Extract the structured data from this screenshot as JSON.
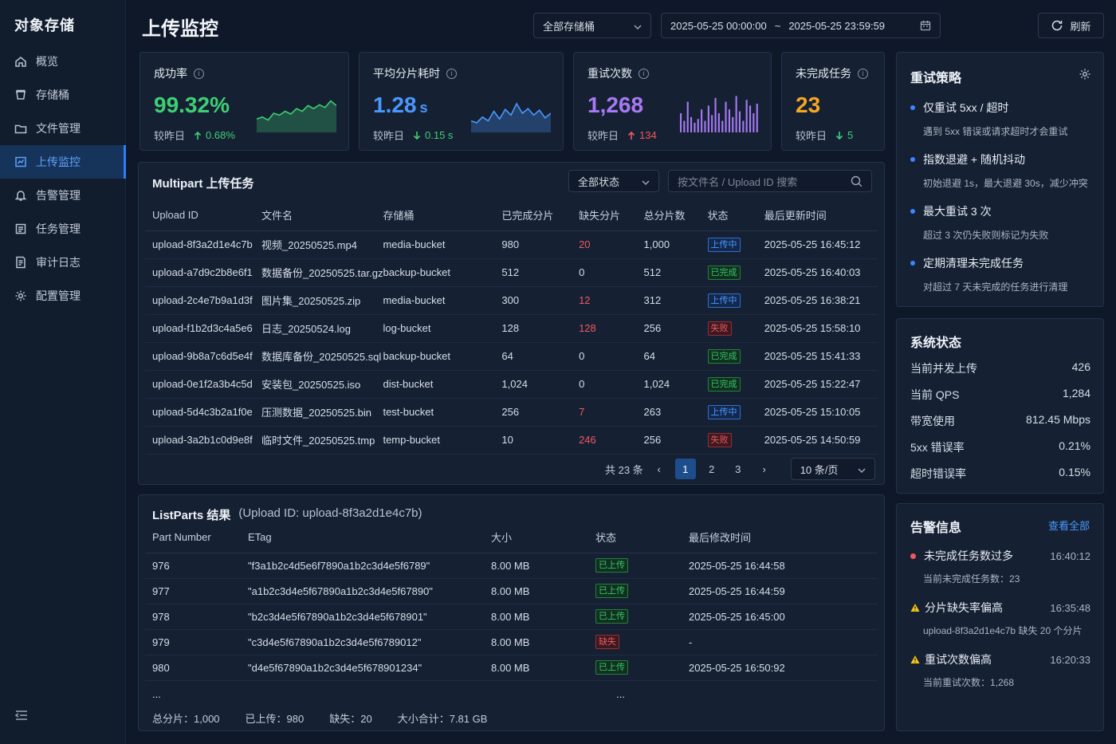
{
  "app": {
    "brand": "对象存储",
    "page_title": "上传监控"
  },
  "nav": [
    {
      "label": "概览",
      "icon": "home-icon"
    },
    {
      "label": "存储桶",
      "icon": "bucket-icon"
    },
    {
      "label": "文件管理",
      "icon": "folder-icon"
    },
    {
      "label": "上传监控",
      "icon": "monitor-icon",
      "active": true
    },
    {
      "label": "告警管理",
      "icon": "bell-icon"
    },
    {
      "label": "任务管理",
      "icon": "list-icon"
    },
    {
      "label": "审计日志",
      "icon": "log-icon"
    },
    {
      "label": "配置管理",
      "icon": "gear-icon"
    }
  ],
  "toolbar": {
    "bucket_select": "全部存储桶",
    "date_start": "2025-05-25 00:00:00",
    "date_sep": "~",
    "date_end": "2025-05-25 23:59:59",
    "refresh": "刷新"
  },
  "kpis": [
    {
      "label": "成功率",
      "value": "99.32%",
      "unit": "",
      "cmp": "较昨日",
      "delta": "0.68%",
      "dir": "up",
      "color": "#3ecf74",
      "trend": [
        0.35,
        0.4,
        0.32,
        0.5,
        0.45,
        0.55,
        0.48,
        0.62,
        0.55,
        0.7,
        0.62,
        0.72,
        0.65,
        0.82,
        0.7
      ]
    },
    {
      "label": "平均分片耗时",
      "value": "1.28",
      "unit": "s",
      "cmp": "较昨日",
      "delta": "0.15 s",
      "dir": "down",
      "color": "#4a98ff",
      "trend": [
        0.3,
        0.25,
        0.4,
        0.3,
        0.55,
        0.35,
        0.6,
        0.45,
        0.75,
        0.5,
        0.62,
        0.45,
        0.58,
        0.38,
        0.5
      ]
    },
    {
      "label": "重试次数",
      "value": "1,268",
      "unit": "",
      "cmp": "较昨日",
      "delta": "134",
      "dir": "up",
      "color": "#a779f5",
      "trend": [
        0.5,
        0.3,
        0.8,
        0.4,
        0.25,
        0.35,
        0.6,
        0.3,
        0.7,
        0.45,
        0.9,
        0.5,
        0.3,
        0.8,
        0.6,
        0.4,
        0.95,
        0.55,
        0.3,
        0.85,
        0.7,
        0.5,
        0.75
      ]
    },
    {
      "label": "未完成任务",
      "value": "23",
      "unit": "",
      "cmp": "较昨日",
      "delta": "5",
      "dir": "down",
      "color": "#f5a623",
      "trend": []
    }
  ],
  "tasks": {
    "title": "Multipart 上传任务",
    "status_select": "全部状态",
    "search_placeholder": "按文件名 / Upload ID 搜索",
    "columns": [
      "Upload ID",
      "文件名",
      "存储桶",
      "已完成分片",
      "缺失分片",
      "总分片数",
      "状态",
      "最后更新时间"
    ],
    "rows": [
      {
        "id": "upload-8f3a2d1e4c7b",
        "file": "视频_20250525.mp4",
        "bucket": "media-bucket",
        "done": "980",
        "missing": "20",
        "total": "1,000",
        "status": "上传中",
        "st": "up",
        "time": "2025-05-25 16:45:12"
      },
      {
        "id": "upload-a7d9c2b8e6f1",
        "file": "数据备份_20250525.tar.gz",
        "bucket": "backup-bucket",
        "done": "512",
        "missing": "0",
        "total": "512",
        "status": "已完成",
        "st": "ok",
        "time": "2025-05-25 16:40:03"
      },
      {
        "id": "upload-2c4e7b9a1d3f",
        "file": "图片集_20250525.zip",
        "bucket": "media-bucket",
        "done": "300",
        "missing": "12",
        "total": "312",
        "status": "上传中",
        "st": "up",
        "time": "2025-05-25 16:38:21"
      },
      {
        "id": "upload-f1b2d3c4a5e6",
        "file": "日志_20250524.log",
        "bucket": "log-bucket",
        "done": "128",
        "missing": "128",
        "total": "256",
        "status": "失败",
        "st": "fail",
        "time": "2025-05-25 15:58:10"
      },
      {
        "id": "upload-9b8a7c6d5e4f",
        "file": "数据库备份_20250525.sql",
        "bucket": "backup-bucket",
        "done": "64",
        "missing": "0",
        "total": "64",
        "status": "已完成",
        "st": "ok",
        "time": "2025-05-25 15:41:33"
      },
      {
        "id": "upload-0e1f2a3b4c5d",
        "file": "安装包_20250525.iso",
        "bucket": "dist-bucket",
        "done": "1,024",
        "missing": "0",
        "total": "1,024",
        "status": "已完成",
        "st": "ok",
        "time": "2025-05-25 15:22:47"
      },
      {
        "id": "upload-5d4c3b2a1f0e",
        "file": "压测数据_20250525.bin",
        "bucket": "test-bucket",
        "done": "256",
        "missing": "7",
        "total": "263",
        "status": "上传中",
        "st": "up",
        "time": "2025-05-25 15:10:05"
      },
      {
        "id": "upload-3a2b1c0d9e8f",
        "file": "临时文件_20250525.tmp",
        "bucket": "temp-bucket",
        "done": "10",
        "missing": "246",
        "total": "256",
        "status": "失败",
        "st": "fail",
        "time": "2025-05-25 14:50:59"
      }
    ],
    "pagination": {
      "total": "共 23 条",
      "pages": [
        "1",
        "2",
        "3"
      ],
      "current": "1",
      "page_size": "10 条/页"
    }
  },
  "listparts": {
    "title": "ListParts 结果",
    "subtitle": "(Upload ID: upload-8f3a2d1e4c7b)",
    "columns": [
      "Part Number",
      "ETag",
      "大小",
      "状态",
      "最后修改时间"
    ],
    "rows": [
      {
        "num": "976",
        "etag": "\"f3a1b2c4d5e6f7890a1b2c3d4e5f6789\"",
        "size": "8.00 MB",
        "status": "已上传",
        "st": "ok",
        "time": "2025-05-25 16:44:58"
      },
      {
        "num": "977",
        "etag": "\"a1b2c3d4e5f67890a1b2c3d4e5f67890\"",
        "size": "8.00 MB",
        "status": "已上传",
        "st": "ok",
        "time": "2025-05-25 16:44:59"
      },
      {
        "num": "978",
        "etag": "\"b2c3d4e5f67890a1b2c3d4e5f678901\"",
        "size": "8.00 MB",
        "status": "已上传",
        "st": "ok",
        "time": "2025-05-25 16:45:00"
      },
      {
        "num": "979",
        "etag": "\"c3d4e5f67890a1b2c3d4e5f6789012\"",
        "size": "8.00 MB",
        "status": "缺失",
        "st": "fail",
        "time": "-"
      },
      {
        "num": "980",
        "etag": "\"d4e5f67890a1b2c3d4e5f678901234\"",
        "size": "8.00 MB",
        "status": "已上传",
        "st": "ok",
        "time": "2025-05-25 16:50:92"
      }
    ],
    "ellipsis": "...",
    "summary": [
      "总分片：1,000",
      "已上传：980",
      "缺失：20",
      "大小合计：7.81 GB"
    ]
  },
  "strategy": {
    "title": "重试策略",
    "items": [
      {
        "h": "仅重试 5xx / 超时",
        "s": "遇到 5xx 错误或请求超时才会重试"
      },
      {
        "h": "指数退避 + 随机抖动",
        "s": "初始退避 1s，最大退避 30s，减少冲突"
      },
      {
        "h": "最大重试 3 次",
        "s": "超过 3 次仍失败则标记为失败"
      },
      {
        "h": "定期清理未完成任务",
        "s": "对超过 7 天未完成的任务进行清理"
      }
    ]
  },
  "system": {
    "title": "系统状态",
    "rows": [
      {
        "k": "当前并发上传",
        "v": "426"
      },
      {
        "k": "当前 QPS",
        "v": "1,284"
      },
      {
        "k": "带宽使用",
        "v": "812.45 Mbps"
      },
      {
        "k": "5xx 错误率",
        "v": "0.21%"
      },
      {
        "k": "超时错误率",
        "v": "0.15%"
      }
    ]
  },
  "alerts": {
    "title": "告警信息",
    "view_all": "查看全部",
    "items": [
      {
        "h": "未完成任务数过多",
        "t": "16:40:12",
        "s": "当前未完成任务数：23",
        "level": "error"
      },
      {
        "h": "分片缺失率偏高",
        "t": "16:35:48",
        "s": "upload-8f3a2d1e4c7b 缺失 20 个分片",
        "level": "warn"
      },
      {
        "h": "重试次数偏高",
        "t": "16:20:33",
        "s": "当前重试次数：1,268",
        "level": "warn"
      }
    ]
  }
}
